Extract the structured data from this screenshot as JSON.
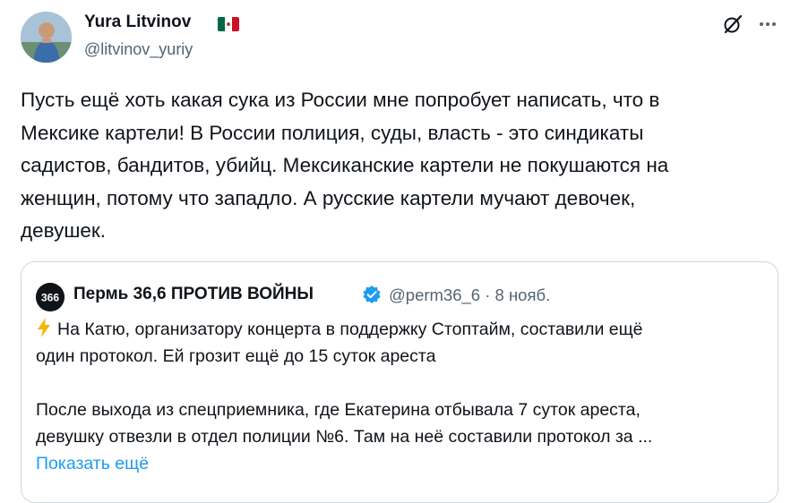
{
  "author": {
    "name": "Yura Litvinov",
    "handle": "@litvinov_yuriy",
    "flag_colors": [
      "#006847",
      "#ffffff",
      "#ce1126"
    ]
  },
  "tweet": {
    "lines": [
      "Пусть ещё хоть какая сука из России мне попробует написать, что в",
      "Мексике картели! В России полиция, суды, власть - это синдикаты",
      "садистов, бандитов, убийц. Мексиканские картели не покушаются на",
      "женщин, потому что западло. А русские картели мучают девочек,",
      "девушек."
    ]
  },
  "quote": {
    "logo_text": "366",
    "name": "Пермь 36,6 ПРОТИВ ВОЙНЫ",
    "meta": "@perm36_6 · 8 нояб.",
    "paragraph1": [
      "На Катю, организатору концерта в поддержку Стоптайм, составили ещё",
      "один протокол. Ей грозит ещё до 15 суток ареста"
    ],
    "paragraph2": [
      "После выхода из спецприемника, где Екатерина отбывала 7 суток ареста,",
      "девушку отвезли в отдел полиции №6. Там на неё составили протокол за ..."
    ],
    "show_more": "Показать ещё"
  },
  "icons": {
    "grok": "grok-icon",
    "more": "more-icon",
    "verified": "verified-badge-icon",
    "zap": "high-voltage-icon"
  },
  "colors": {
    "text": "#0f1419",
    "secondary": "#536471",
    "accent": "#1d9bf0",
    "border": "#cfd9de",
    "zap": "#f4b400"
  }
}
